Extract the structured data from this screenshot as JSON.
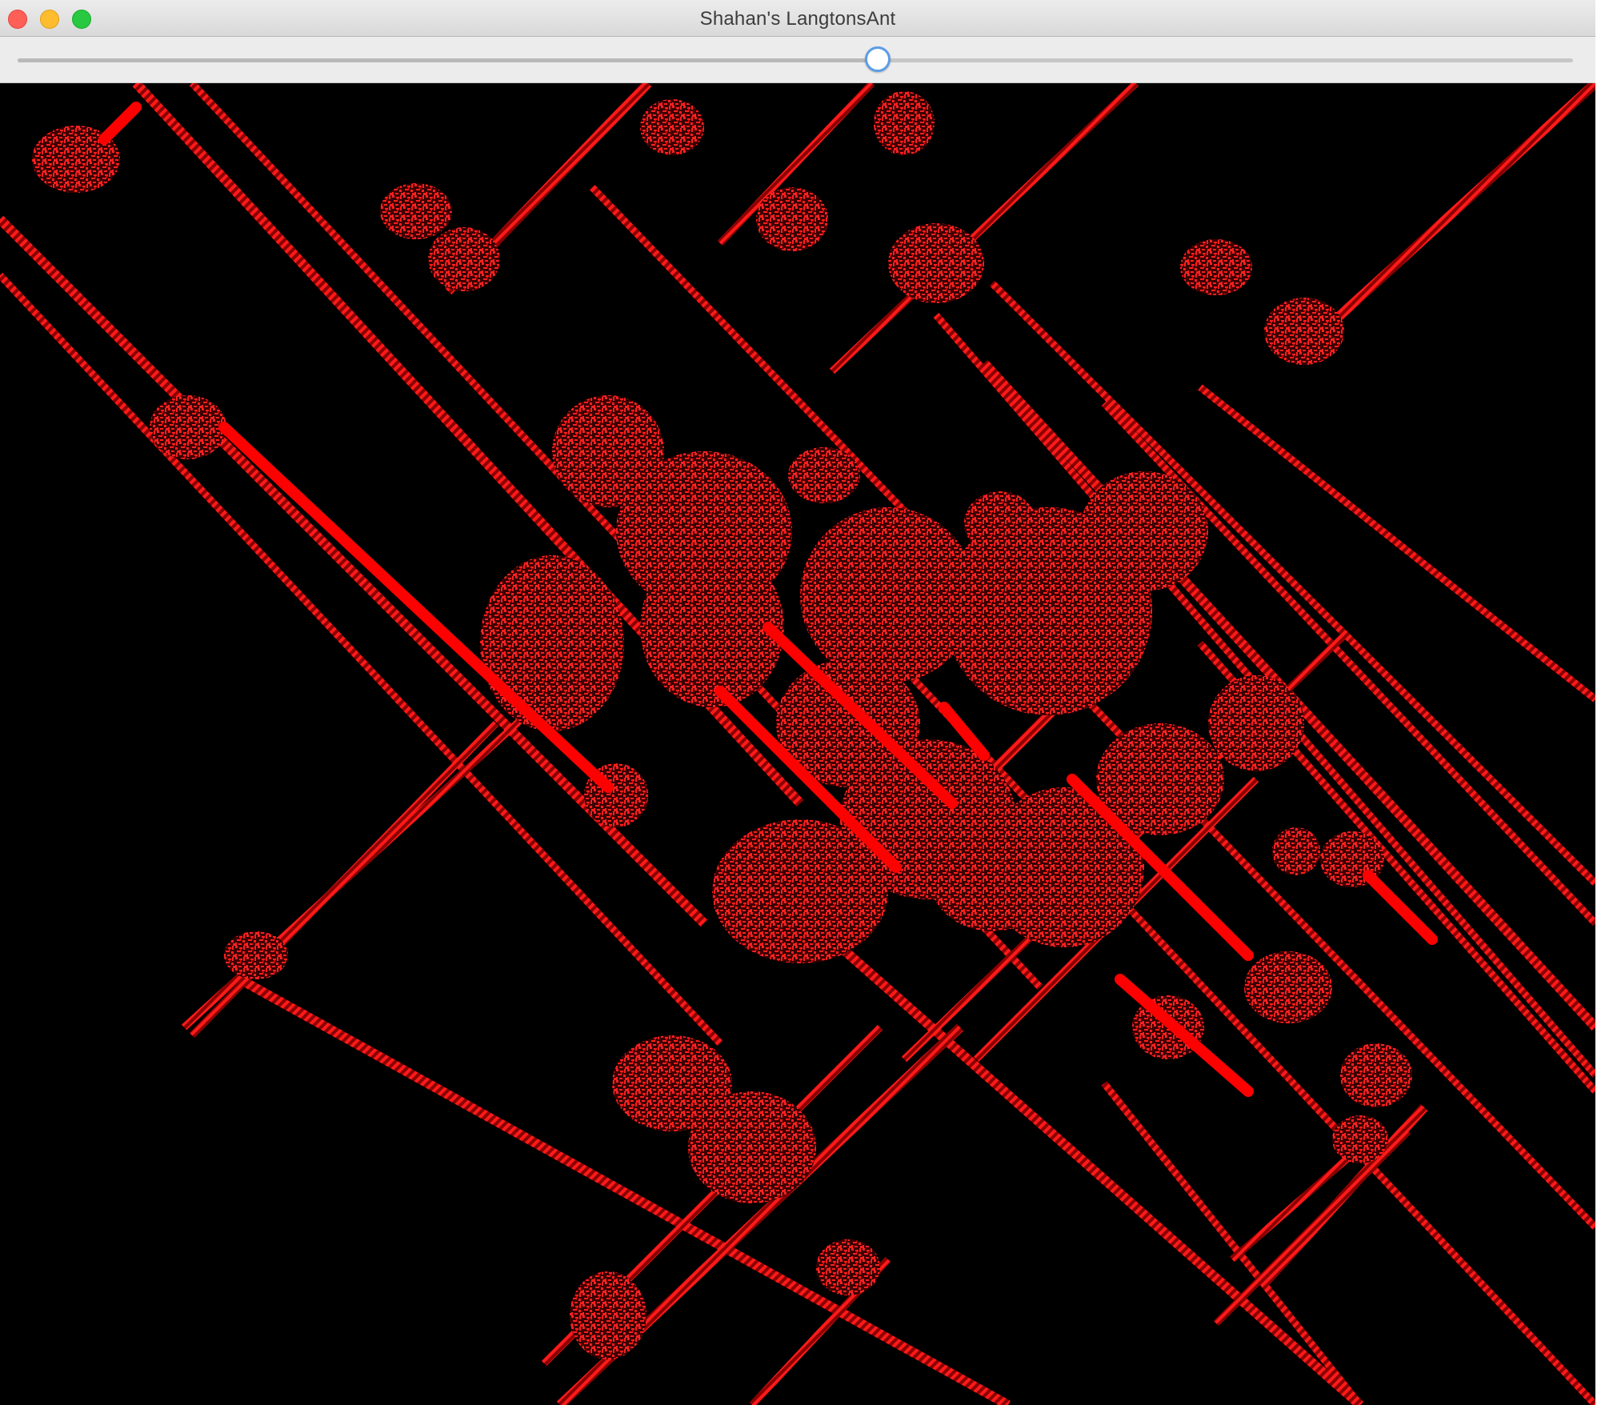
{
  "window": {
    "title": "Shahan's LangtonsAnt"
  },
  "controls": {
    "speed_slider": {
      "value_fraction": 0.553
    }
  },
  "canvas": {
    "background_color": "#000000",
    "cell_color": "#ff0000"
  }
}
